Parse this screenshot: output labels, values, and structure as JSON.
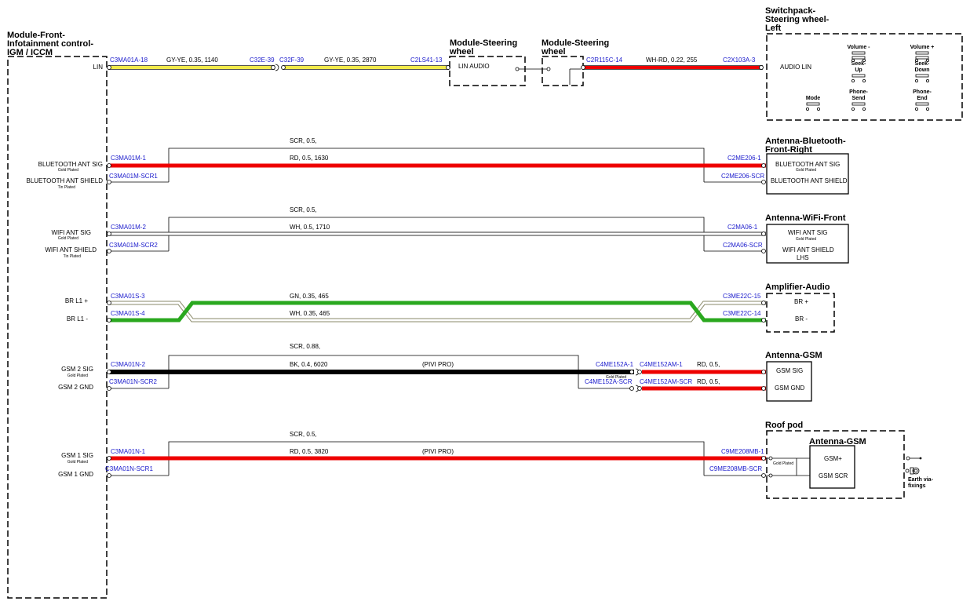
{
  "blocks": {
    "igm": {
      "title1": "Module-Front-",
      "title2": "Infotainment control-",
      "title3": "IGM / ICCM"
    },
    "steering1": {
      "title1": "Module-Steering",
      "title2": "wheel",
      "pin_label": "LIN AUDIO"
    },
    "steering2": {
      "title1": "Module-Steering",
      "title2": "wheel"
    },
    "switchpack": {
      "title1": "Switchpack-",
      "title2": "Steering wheel-",
      "title3": "Left",
      "audio_lin": "AUDIO LIN",
      "switches": [
        {
          "line1": "Volume -",
          "line2": ""
        },
        {
          "line1": "Volume +",
          "line2": ""
        },
        {
          "line1": "Seek-",
          "line2": "Up"
        },
        {
          "line1": "Seek-",
          "line2": "Down"
        },
        {
          "line1": "Mode",
          "line2": ""
        },
        {
          "line1": "Phone-",
          "line2": "Send"
        },
        {
          "line1": "Phone-",
          "line2": "End"
        }
      ]
    },
    "bt_antenna": {
      "title1": "Antenna-Bluetooth-",
      "title2": "Front-Right",
      "pin1": "BLUETOOTH ANT SIG",
      "pin1_sub": "Gold Plated",
      "pin2": "BLUETOOTH ANT SHIELD"
    },
    "wifi_antenna": {
      "title": "Antenna-WiFi-Front",
      "pin1": "WIFI ANT SIG",
      "pin1_sub": "Gold Plated",
      "pin2": "WIFI ANT SHIELD",
      "pin3": "LHS"
    },
    "amplifier": {
      "title": "Amplifier-Audio",
      "pin1": "BR +",
      "pin2": "BR -"
    },
    "gsm_antenna": {
      "title": "Antenna-GSM",
      "pin1": "GSM SIG",
      "pin2": "GSM GND"
    },
    "roof_pod": {
      "title": "Roof pod",
      "inner_title": "Antenna-GSM",
      "pin1": "GSM+",
      "pin2": "GSM SCR",
      "gold": "Gold Plated",
      "earth1": "Earth via-",
      "earth2": "fixings"
    }
  },
  "igm_pins": [
    {
      "label": "LIN",
      "sub": ""
    },
    {
      "label": "BLUETOOTH ANT SIG",
      "sub": "Gold Plated"
    },
    {
      "label": "BLUETOOTH ANT SHIELD",
      "sub": "Tin Plated"
    },
    {
      "label": "WIFI ANT SIG",
      "sub": "Gold Plated"
    },
    {
      "label": "WIFI ANT SHIELD",
      "sub": "Tin Plated"
    },
    {
      "label": "BR L1 +",
      "sub": ""
    },
    {
      "label": "BR L1 -",
      "sub": ""
    },
    {
      "label": "GSM 2 SIG",
      "sub": "Gold Plated"
    },
    {
      "label": "GSM 2 GND",
      "sub": ""
    },
    {
      "label": "GSM 1 SIG",
      "sub": "Gold Plated"
    },
    {
      "label": "GSM 1 GND",
      "sub": ""
    }
  ],
  "connectors": {
    "lin_a": "C3MA01A-18",
    "lin_b": "C32E-39",
    "lin_c": "C32F-39",
    "lin_d": "C2LS41-13",
    "lin_e": "C2R115C-14",
    "lin_f": "C2X103A-3",
    "bt_a": "C3MA01M-1",
    "bt_b": "C3MA01M-SCR1",
    "bt_c": "C2ME206-1",
    "bt_d": "C2ME206-SCR",
    "wifi_a": "C3MA01M-2",
    "wifi_b": "C3MA01M-SCR2",
    "wifi_c": "C2MA06-1",
    "wifi_d": "C2MA06-SCR",
    "br_a": "C3MA01S-3",
    "br_b": "C3MA01S-4",
    "br_c": "C3ME22C-15",
    "br_d": "C3ME22C-14",
    "gsm2_a": "C3MA01N-2",
    "gsm2_b": "C3MA01N-SCR2",
    "gsm2_c": "C4ME152A-1",
    "gsm2_d": "C4ME152AM-1",
    "gsm2_e": "C4ME152A-SCR",
    "gsm2_f": "C4ME152AM-SCR",
    "gsm2_gold": "Gold Plated",
    "gsm1_a": "C3MA01N-1",
    "gsm1_b": "C3MA01N-SCR1",
    "gsm1_c": "C9ME208MB-1",
    "gsm1_d": "C9ME208MB-SCR"
  },
  "wires": {
    "lin1": "GY-YE,  0.35,  1140",
    "lin2": "GY-YE,  0.35,  2870",
    "lin3": "WH-RD,  0.22,  255",
    "bt_scr": "SCR,  0.5,",
    "bt_sig": "RD,  0.5,  1630",
    "wifi_scr": "SCR,  0.5,",
    "wifi_sig": "WH,  0.5,  1710",
    "br_plus": "GN,  0.35,  465",
    "br_minus": "WH,  0.35,  465",
    "gsm2_scr": "SCR,  0.88,",
    "gsm2_sig": "BK,  0.4,  6020",
    "gsm2_note": "(PIVI PRO)",
    "gsm2_ext1": "RD,  0.5,",
    "gsm2_ext2": "RD,  0.5,",
    "gsm1_scr": "SCR,  0.5,",
    "gsm1_sig": "RD,  0.5,  3820",
    "gsm1_note": "(PIVI PRO)"
  },
  "colors": {
    "yellow": "#f2ea4a",
    "red": "#ee0000",
    "green": "#2aa81f",
    "black": "#000000",
    "connector_text": "#1a1acc"
  }
}
